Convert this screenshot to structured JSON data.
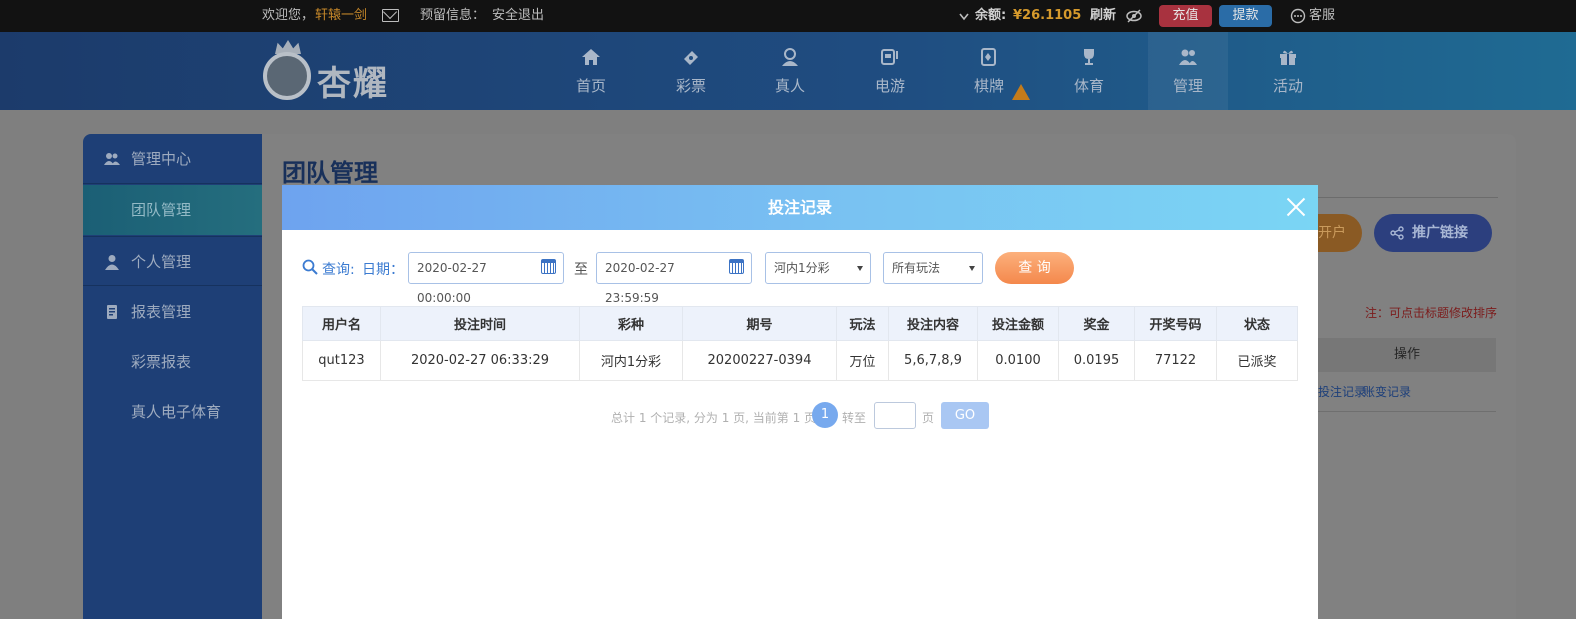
{
  "topbar": {
    "welcome": "欢迎您，",
    "username": "轩辕一剑",
    "reserved_info": "预留信息：",
    "logout": "安全退出",
    "balance_label": "余额:",
    "balance_value": "¥26.1105",
    "refresh": "刷新",
    "recharge": "充值",
    "withdraw": "提款",
    "service": "客服"
  },
  "brand": {
    "name": "杏耀"
  },
  "nav": [
    {
      "label": "首页",
      "icon": "home-icon"
    },
    {
      "label": "彩票",
      "icon": "ticket-icon"
    },
    {
      "label": "真人",
      "icon": "dealer-icon"
    },
    {
      "label": "电游",
      "icon": "slot-icon"
    },
    {
      "label": "棋牌",
      "icon": "cards-icon"
    },
    {
      "label": "体育",
      "icon": "trophy-icon"
    },
    {
      "label": "管理",
      "icon": "users-icon"
    },
    {
      "label": "活动",
      "icon": "gift-icon"
    }
  ],
  "sidebar": {
    "items": [
      {
        "label": "管理中心",
        "icon": "users-icon"
      },
      {
        "label": "团队管理"
      },
      {
        "label": "个人管理",
        "icon": "user-icon"
      },
      {
        "label": "报表管理",
        "icon": "report-icon"
      },
      {
        "label": "彩票报表"
      },
      {
        "label": "真人电子体育"
      }
    ]
  },
  "page": {
    "title": "团队管理",
    "open_account": "开户",
    "promo_link": "推广链接",
    "sort_note": "注：可点击标题修改排序",
    "col_action": "操作",
    "link_bet_records": "投注记录",
    "link_account_records": "账变记录"
  },
  "modal": {
    "title": "投注记录",
    "query_label": "查询:",
    "date_label": "日期：",
    "date_from": "2020-02-27 00:00:00",
    "date_sep": "至",
    "date_to": "2020-02-27 23:59:59",
    "lottery_select": "河内1分彩",
    "play_select": "所有玩法",
    "query_button": "查 询",
    "columns": [
      "用户名",
      "投注时间",
      "彩种",
      "期号",
      "玩法",
      "投注内容",
      "投注金额",
      "奖金",
      "开奖号码",
      "状态"
    ],
    "rows": [
      [
        "qut123",
        "2020-02-27 06:33:29",
        "河内1分彩",
        "20200227-0394",
        "万位",
        "5,6,7,8,9",
        "0.0100",
        "0.0195",
        "77122",
        "已派奖"
      ]
    ],
    "pager": {
      "summary": "总计 1 个记录, 分为 1 页, 当前第 1 页",
      "current_page": "1",
      "goto_label": "转至",
      "page_suffix": "页",
      "go_button": "GO"
    }
  },
  "colors": {
    "modal_header_start": "#6ea3ef",
    "modal_header_end": "#7ad5f4",
    "query_button": "#f4884c",
    "status_paid": "#e27324",
    "link_blue": "#3b7bd1"
  }
}
